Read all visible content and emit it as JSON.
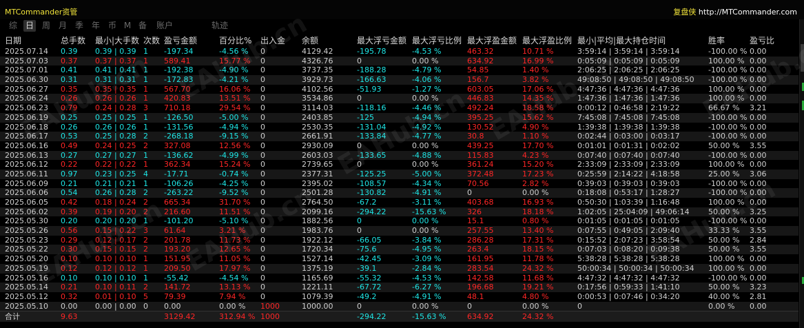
{
  "app_title": "MTCommander资管",
  "brand": {
    "name": "复盘侠",
    "url": "http://MTCommander.com"
  },
  "tabs": [
    "综",
    "日",
    "周",
    "月",
    "季",
    "年",
    "币",
    "M",
    "备",
    "账户",
    "轨迹"
  ],
  "active_tab": 1,
  "watermark": "EAHub.cn",
  "colors": {
    "profit": "#ff2626",
    "loss": "#1ee6e6",
    "neutral": "#d0d0d0",
    "title": "#f2e43a"
  },
  "columns": [
    "日期",
    "总手数",
    "最小|大手数",
    "次数",
    "盈亏金额",
    "百分比%",
    "出入金",
    "余额",
    "最大浮亏金额",
    "最大浮亏比例",
    "最大浮盈金额",
    "最大浮盈比例",
    "最小|平均|最大持仓时间",
    "胜率",
    "盈亏比"
  ],
  "rows": [
    {
      "s": "n",
      "c": [
        "2025.07.14",
        "0.39",
        "0.39 | 0.39",
        "1",
        "-197.34",
        "-4.56 %",
        "0",
        "4129.42",
        "-195.78",
        "-4.53 %",
        "463.32",
        "10.71 %",
        "3:59:14 | 3:59:14 | 3:59:14",
        "-100.00 %",
        "0.00"
      ]
    },
    {
      "s": "p",
      "c": [
        "2025.07.03",
        "0.37",
        "0.37 | 0.37",
        "1",
        "589.41",
        "15.77 %",
        "0",
        "4326.76",
        "0",
        "0.00 %",
        "634.92",
        "16.99 %",
        "0:05:09 | 0:05:09 | 0:05:09",
        "100.00 %",
        "0.00"
      ]
    },
    {
      "s": "n",
      "c": [
        "2025.07.01",
        "0.41",
        "0.41 | 0.41",
        "1",
        "-192.38",
        "-4.90 %",
        "0",
        "3737.35",
        "-188.28",
        "-4.79 %",
        "54.85",
        "1.40 %",
        "2:06:25 | 2:06:25 | 2:06:25",
        "-100.00 %",
        "0.00"
      ]
    },
    {
      "s": "n",
      "c": [
        "2025.06.30",
        "0.31",
        "0.31 | 0.31",
        "1",
        "-172.83",
        "-4.21 %",
        "0",
        "3929.73",
        "-166.63",
        "-4.06 %",
        "156.7",
        "3.82 %",
        "49:08:50 | 49:08:50 | 49:08:50",
        "-100.00 %",
        "0.00"
      ]
    },
    {
      "s": "p",
      "c": [
        "2025.06.27",
        "0.35",
        "0.35 | 0.35",
        "1",
        "567.70",
        "16.06 %",
        "0",
        "4102.56",
        "-51.93",
        "-1.27 %",
        "603.05",
        "17.06 %",
        "4:47:36 | 4:47:36 | 4:47:36",
        "100.00 %",
        "0.00"
      ]
    },
    {
      "s": "p",
      "c": [
        "2025.06.24",
        "0.26",
        "0.26 | 0.26",
        "1",
        "420.83",
        "13.51 %",
        "0",
        "3534.86",
        "0",
        "0.00 %",
        "446.83",
        "14.35 %",
        "1:47:36 | 1:47:36 | 1:47:36",
        "100.00 %",
        "0.00"
      ]
    },
    {
      "s": "p",
      "c": [
        "2025.06.23",
        "0.79",
        "0.24 | 0.28",
        "3",
        "710.18",
        "29.54 %",
        "0",
        "3114.03",
        "-118.16",
        "-4.46 %",
        "492.24",
        "18.58 %",
        "0:00:12 | 0:46:58 | 2:19:22",
        "66.67 %",
        "3.21"
      ]
    },
    {
      "s": "n",
      "c": [
        "2025.06.19",
        "0.25",
        "0.25 | 0.25",
        "1",
        "-126.50",
        "-5.00 %",
        "0",
        "2403.85",
        "-125",
        "-4.94 %",
        "395.25",
        "15.62 %",
        "7:45:08 | 7:45:08 | 7:45:08",
        "-100.00 %",
        "0.00"
      ]
    },
    {
      "s": "n",
      "c": [
        "2025.06.18",
        "0.26",
        "0.26 | 0.26",
        "1",
        "-131.56",
        "-4.94 %",
        "0",
        "2530.35",
        "-131.04",
        "-4.92 %",
        "130.52",
        "4.90 %",
        "1:39:38 | 1:39:38 | 1:39:38",
        "-100.00 %",
        "0.00"
      ]
    },
    {
      "s": "n",
      "c": [
        "2025.06.17",
        "0.53",
        "0.25 | 0.28",
        "2",
        "-268.18",
        "-9.15 %",
        "0",
        "2661.91",
        "-133.84",
        "-4.77 %",
        "30.8",
        "1.10 %",
        "0:02:44 | 0:03:00 | 0:03:17",
        "-100.00 %",
        "0.00"
      ]
    },
    {
      "s": "p",
      "c": [
        "2025.06.16",
        "0.49",
        "0.24 | 0.25",
        "2",
        "327.08",
        "12.56 %",
        "0",
        "2930.09",
        "0",
        "0.00 %",
        "439.25",
        "17.70 %",
        "0:01:01 | 0:01:31 | 0:02:02",
        "50.00 %",
        "3.55"
      ]
    },
    {
      "s": "n",
      "c": [
        "2025.06.13",
        "0.27",
        "0.27 | 0.27",
        "1",
        "-136.62",
        "-4.99 %",
        "0",
        "2603.03",
        "-133.65",
        "-4.88 %",
        "115.83",
        "4.23 %",
        "0:07:40 | 0:07:40 | 0:07:40",
        "-100.00 %",
        "0.00"
      ]
    },
    {
      "s": "p",
      "c": [
        "2025.06.12",
        "0.22",
        "0.22 | 0.22",
        "1",
        "362.34",
        "15.24 %",
        "0",
        "2739.65",
        "0",
        "0.00 %",
        "361.24",
        "15.20 %",
        "2:33:09 | 2:33:09 | 2:33:09",
        "100.00 %",
        "0.00"
      ]
    },
    {
      "s": "n",
      "c": [
        "2025.06.11",
        "0.97",
        "0.23 | 0.25",
        "4",
        "-17.71",
        "-0.74 %",
        "0",
        "2377.31",
        "-125.25",
        "-5.00 %",
        "372.48",
        "17.23 %",
        "0:25:59 | 2:14:22 | 4:18:58",
        "25.00 %",
        "3.06"
      ]
    },
    {
      "s": "n",
      "c": [
        "2025.06.09",
        "0.21",
        "0.21 | 0.21",
        "1",
        "-106.26",
        "-4.25 %",
        "0",
        "2395.02",
        "-108.57",
        "-4.34 %",
        "70.56",
        "2.82 %",
        "0:39:03 | 0:39:03 | 0:39:03",
        "-100.00 %",
        "0.00"
      ]
    },
    {
      "s": "n",
      "c": [
        "2025.06.06",
        "0.54",
        "0.26 | 0.28",
        "2",
        "-263.22",
        "-9.52 %",
        "0",
        "2501.28",
        "-130.82",
        "-4.91 %",
        "0",
        "0.00 %",
        "0:18:08 | 0:53:17 | 1:28:27",
        "-100.00 %",
        "0.00"
      ]
    },
    {
      "s": "p",
      "c": [
        "2025.06.05",
        "0.42",
        "0.18 | 0.24",
        "2",
        "665.34",
        "31.70 %",
        "0",
        "2764.50",
        "-67.2",
        "-3.11 %",
        "403.68",
        "16.93 %",
        "0:50:30 | 1:03:39 | 1:16:48",
        "100.00 %",
        "0.00"
      ]
    },
    {
      "s": "p",
      "c": [
        "2025.06.02",
        "0.39",
        "0.19 | 0.20",
        "2",
        "216.60",
        "11.51 %",
        "0",
        "2099.16",
        "-294.22",
        "-15.63 %",
        "326",
        "18.18 %",
        "1:02:05 | 25:04:09 | 49:06:14",
        "50.00 %",
        "3.25"
      ]
    },
    {
      "s": "n",
      "c": [
        "2025.05.30",
        "0.20",
        "0.20 | 0.20",
        "1",
        "-101.20",
        "-5.10 %",
        "0",
        "1882.56",
        "0",
        "0.00 %",
        "15.1",
        "0.80 %",
        "0:01:05 | 0:01:05 | 0:01:05",
        "-100.00 %",
        "0.00"
      ]
    },
    {
      "s": "p",
      "c": [
        "2025.05.26",
        "0.56",
        "0.15 | 0.22",
        "3",
        "61.64",
        "3.21 %",
        "0",
        "1983.76",
        "0",
        "0.00 %",
        "257.55",
        "13.40 %",
        "0:07:55 | 0:49:05 | 2:09:40",
        "33.33 %",
        "3.55"
      ]
    },
    {
      "s": "p",
      "c": [
        "2025.05.23",
        "0.29",
        "0.12 | 0.17",
        "2",
        "201.78",
        "11.73 %",
        "0",
        "1922.12",
        "-66.05",
        "-3.84 %",
        "286.28",
        "17.31 %",
        "0:15:52 | 2:07:23 | 3:58:54",
        "50.00 %",
        "2.84"
      ]
    },
    {
      "s": "p",
      "c": [
        "2025.05.22",
        "0.30",
        "0.15 | 0.15",
        "2",
        "193.20",
        "12.65 %",
        "0",
        "1720.34",
        "-75.6",
        "-4.95 %",
        "263.4",
        "18.15 %",
        "0:07:03 | 0:08:20 | 0:09:38",
        "50.00 %",
        "3.55"
      ]
    },
    {
      "s": "p",
      "c": [
        "2025.05.20",
        "0.10",
        "0.10 | 0.10",
        "1",
        "151.95",
        "11.05 %",
        "0",
        "1527.14",
        "-42.45",
        "-3.09 %",
        "161.95",
        "11.78 %",
        "5:38:28 | 5:38:28 | 5:38:28",
        "100.00 %",
        "0.00"
      ]
    },
    {
      "s": "p",
      "c": [
        "2025.05.19",
        "0.12",
        "0.12 | 0.12",
        "1",
        "209.50",
        "17.97 %",
        "0",
        "1375.19",
        "-39.1",
        "-2.84 %",
        "283.54",
        "24.32 %",
        "50:00:34 | 50:00:34 | 50:00:34",
        "100.00 %",
        "0.00"
      ]
    },
    {
      "s": "n",
      "c": [
        "2025.05.16",
        "0.10",
        "0.10 | 0.10",
        "1",
        "-55.42",
        "-4.54 %",
        "0",
        "1165.69",
        "-55.32",
        "-4.53 %",
        "142.58",
        "11.68 %",
        "4:47:32 | 4:47:32 | 4:47:32",
        "-100.00 %",
        "0.00"
      ]
    },
    {
      "s": "p",
      "c": [
        "2025.05.14",
        "0.21",
        "0.10 | 0.11",
        "2",
        "141.72",
        "13.13 %",
        "0",
        "1221.11",
        "-67.72",
        "-6.27 %",
        "196.68",
        "19.21 %",
        "0:17:56 | 0:59:33 | 1:41:10",
        "50.00 %",
        "3.23"
      ]
    },
    {
      "s": "p",
      "c": [
        "2025.05.12",
        "0.32",
        "0.01 | 0.10",
        "5",
        "79.39",
        "7.94 %",
        "0",
        "1079.39",
        "-49.2",
        "-4.91 %",
        "48.1",
        "4.80 %",
        "0:00:53 | 0:07:46 | 0:34:20",
        "40.00 %",
        "2.81"
      ]
    },
    {
      "s": "z",
      "c": [
        "2025.05.10",
        "0.00",
        "0.00 | 0.00",
        "0",
        "0.00",
        "0.00 %",
        "1000",
        "1000.00",
        "0",
        "0.00 %",
        "0",
        "0.00 %",
        "0",
        "0.00 %",
        "0.00"
      ]
    }
  ],
  "total": {
    "label": "合计",
    "lots": "9.63",
    "pnl": "3129.42",
    "pct": "312.94 %",
    "deposit": "1000",
    "max_float_loss": "-294.22",
    "max_float_loss_pct": "-15.63 %",
    "max_float_profit": "634.92",
    "max_float_profit_pct": "24.32 %"
  }
}
